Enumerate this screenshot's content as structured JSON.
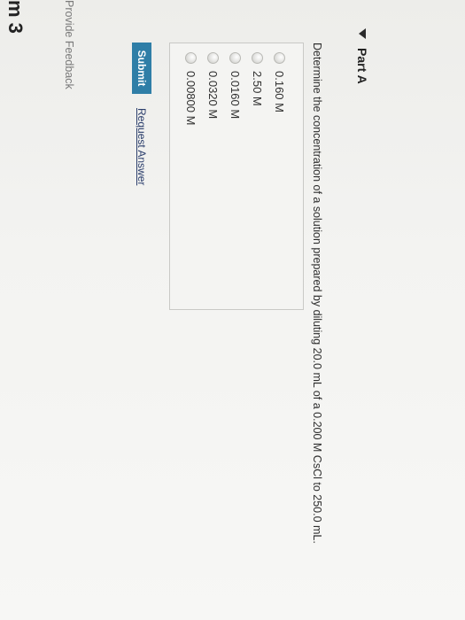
{
  "item": {
    "title_fragment": "m 3"
  },
  "part": {
    "label": "Part A",
    "question": "Determine the concentration of a solution prepared by diluting 20.0 mL of a 0.200 M CsCl to 250.0 mL.",
    "choices": [
      {
        "label": "0.160 M"
      },
      {
        "label": "2.50 M"
      },
      {
        "label": "0.0160 M"
      },
      {
        "label": "0.0320 M"
      },
      {
        "label": "0.00800 M"
      }
    ],
    "submit_label": "Submit",
    "request_answer_label": "Request Answer"
  },
  "footer": {
    "feedback_label": "Provide Feedback"
  },
  "colors": {
    "submit_bg": "#2f7ea7",
    "link": "#2a3d6b"
  },
  "icons": {
    "part_toggle": "caret-down-icon",
    "choice_marker": "radio-circle"
  }
}
